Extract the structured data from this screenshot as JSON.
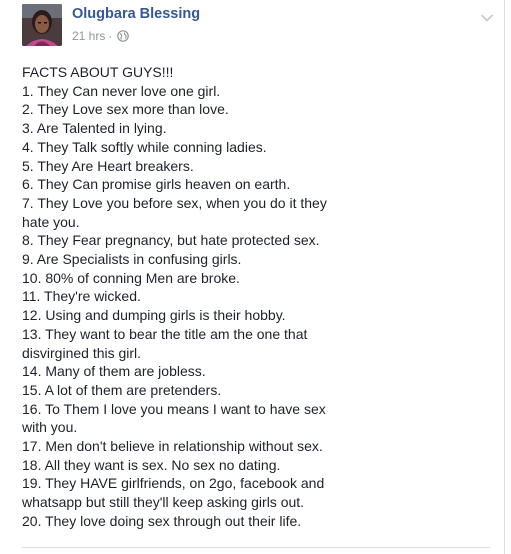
{
  "post": {
    "author": "Olugbara Blessing",
    "time": "21 hrs",
    "separator": "·",
    "privacy_icon": "globe-icon",
    "menu_icon": "chevron-down-icon",
    "lines": [
      "FACTS ABOUT GUYS!!!",
      "1. They Can never love one girl.",
      "2. They Love sex more than love.",
      "3. Are Talented in lying.",
      "4. They Talk softly while conning ladies.",
      "5. They Are Heart breakers.",
      "6. They Can promise girls heaven on earth.",
      "7. They Love you before sex, when you do it they",
      "hate you.",
      "8. They Fear pregnancy, but hate protected sex.",
      "9. Are Specialists in confusing girls.",
      "10. 80% of conning Men are broke.",
      "11. They're wicked.",
      "12. Using and dumping girls is their hobby.",
      "13. They want to bear the title am the one that",
      "disvirgined this girl.",
      "14. Many of them are jobless.",
      "15. A lot of them are pretenders.",
      "16. To Them I love you means I want to have sex",
      "with you.",
      "17. Men don't believe in relationship without sex.",
      "18. All they want is sex. No sex no dating.",
      "19. They HAVE girlfriends, on 2go, facebook and",
      "whatsapp but still they'll keep asking girls out.",
      "20. They love doing sex through out their life."
    ]
  },
  "colors": {
    "author_link": "#365899",
    "meta_text": "#90949c",
    "body_text": "#1d2129",
    "divider": "#dddfe2"
  }
}
